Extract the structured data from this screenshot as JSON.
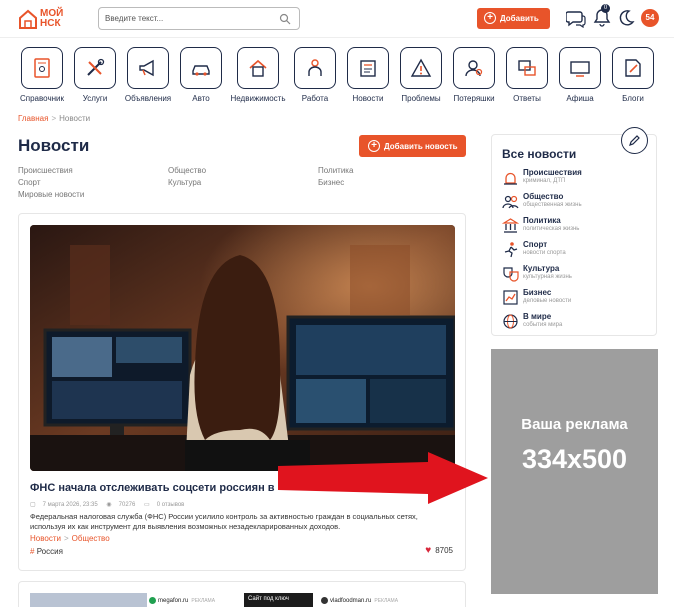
{
  "header": {
    "logo_line1": "МОЙ",
    "logo_line2": "НСК",
    "search_placeholder": "Введите текст...",
    "add_label": "Добавить",
    "notif_count": "0",
    "weather": "54"
  },
  "nav": [
    {
      "label": "Справочник",
      "icon": "book-icon"
    },
    {
      "label": "Услуги",
      "icon": "tools-icon"
    },
    {
      "label": "Объявления",
      "icon": "megaphone-icon"
    },
    {
      "label": "Авто",
      "icon": "car-icon"
    },
    {
      "label": "Недвижимость",
      "icon": "house-icon"
    },
    {
      "label": "Работа",
      "icon": "worker-icon"
    },
    {
      "label": "Новости",
      "icon": "newspaper-icon"
    },
    {
      "label": "Проблемы",
      "icon": "warning-icon"
    },
    {
      "label": "Потеряшки",
      "icon": "person-search-icon"
    },
    {
      "label": "Ответы",
      "icon": "qa-icon"
    },
    {
      "label": "Афиша",
      "icon": "tv-icon"
    },
    {
      "label": "Блоги",
      "icon": "blog-icon"
    }
  ],
  "breadcrumb": {
    "home": "Главная",
    "sep": ">",
    "current": "Новости"
  },
  "page": {
    "title": "Новости",
    "add_news": "Добавить новость"
  },
  "subcategories": [
    "Происшествия",
    "Общество",
    "Политика",
    "Спорт",
    "Культура",
    "Бизнес",
    "Мировые новости"
  ],
  "article": {
    "title": "ФНС начала отслеживать соцсети россиян в",
    "date": "7 марта 2026, 23:35",
    "views": "70276",
    "comments": "0 отзывов",
    "excerpt": "Федеральная налоговая служба (ФНС) России усилило контроль за активностью граждан в социальных сетях, используя их как инструмент для выявления возможных незадекларированных доходов.",
    "cat1": "Новости",
    "cat2": "Общество",
    "tag": "Россия",
    "likes": "8705"
  },
  "ads_strip": {
    "src1": "megafon.ru",
    "src1_tag": "РЕКЛАМА",
    "black_text": "Сайт под ключ",
    "src2": "vladfoodman.ru",
    "src2_tag": "РЕКЛАМА"
  },
  "sidebar": {
    "title": "Все новости",
    "items": [
      {
        "title": "Происшествия",
        "sub": "криминал, ДТП",
        "icon": "siren-icon"
      },
      {
        "title": "Общество",
        "sub": "общественная жизнь",
        "icon": "people-icon"
      },
      {
        "title": "Политика",
        "sub": "политическая жизнь",
        "icon": "government-icon"
      },
      {
        "title": "Спорт",
        "sub": "новости спорта",
        "icon": "running-icon"
      },
      {
        "title": "Культура",
        "sub": "культурная жизнь",
        "icon": "theater-icon"
      },
      {
        "title": "Бизнес",
        "sub": "деловые новости",
        "icon": "chart-icon"
      },
      {
        "title": "В мире",
        "sub": "события мира",
        "icon": "globe-icon"
      }
    ]
  },
  "ad_banner": {
    "line1": "Ваша реклама",
    "line2": "334x500"
  },
  "colors": {
    "accent": "#e8542a",
    "navy": "#1f2b48",
    "arrow": "#e0141e",
    "ad_bg": "#9e9e9e"
  }
}
